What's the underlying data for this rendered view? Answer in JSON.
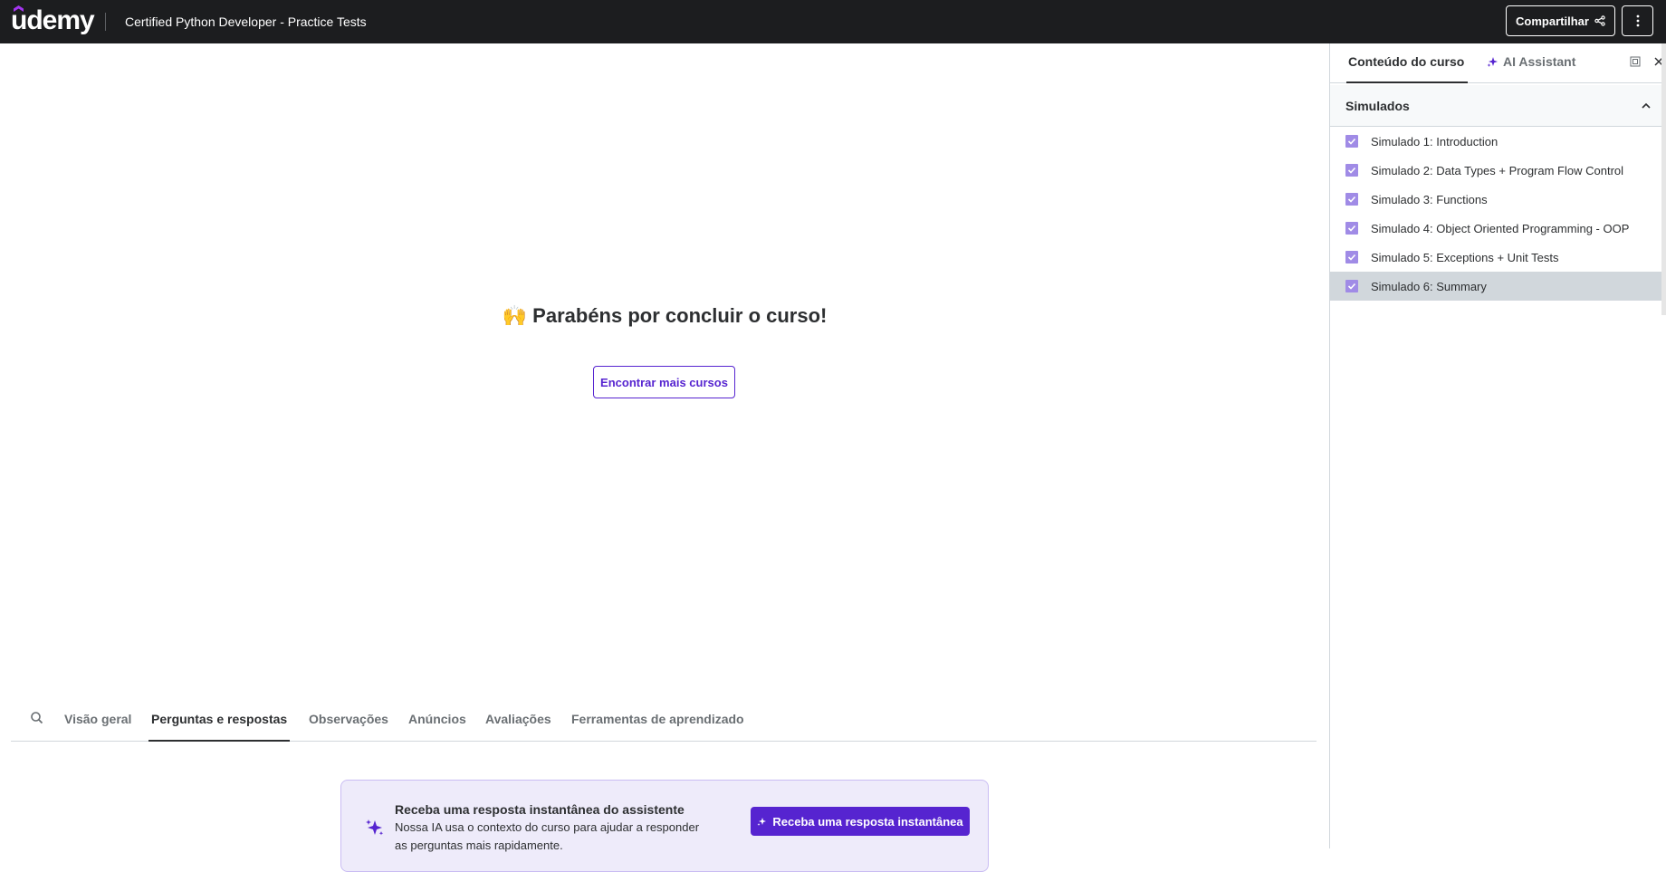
{
  "header": {
    "logo_text": "udemy",
    "course_title": "Certified Python Developer - Practice Tests",
    "share_label": "Compartilhar"
  },
  "main": {
    "congrats_emoji": "🙌",
    "congrats_text": "Parabéns por concluir o curso!",
    "find_courses_label": "Encontrar mais cursos",
    "tabs": [
      {
        "label": "Visão geral"
      },
      {
        "label": "Perguntas e respostas"
      },
      {
        "label": "Observações"
      },
      {
        "label": "Anúncios"
      },
      {
        "label": "Avaliações"
      },
      {
        "label": "Ferramentas de aprendizado"
      }
    ],
    "active_tab": "Perguntas e respostas",
    "ai_banner": {
      "title": "Receba uma resposta instantânea do assistente",
      "description": "Nossa IA usa o contexto do curso para ajudar a responder as perguntas mais rapidamente.",
      "button_label": "Receba uma resposta instantânea"
    }
  },
  "sidebar": {
    "tab_content": "Conteúdo do curso",
    "tab_ai": "AI Assistant",
    "section_title": "Simulados",
    "lessons": [
      {
        "label": "Simulado 1: Introduction",
        "checked": true
      },
      {
        "label": "Simulado 2: Data Types + Program Flow Control",
        "checked": true
      },
      {
        "label": "Simulado 3: Functions",
        "checked": true
      },
      {
        "label": "Simulado 4: Object Oriented Programming - OOP",
        "checked": true
      },
      {
        "label": "Simulado 5: Exceptions + Unit Tests",
        "checked": true
      },
      {
        "label": "Simulado 6: Summary",
        "checked": true
      }
    ]
  },
  "colors": {
    "header_bg": "#1c1d1f",
    "accent_purple": "#5624d0",
    "banner_bg": "#eeebfa",
    "checkbox": "#a08be6"
  }
}
